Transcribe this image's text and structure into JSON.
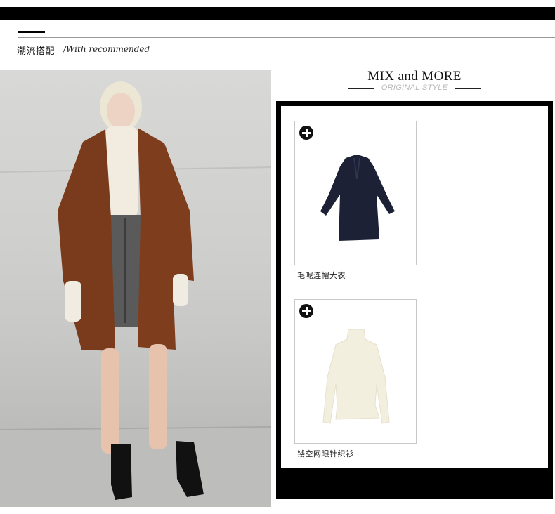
{
  "header": {
    "title": "潮流搭配",
    "subtitle": "/With recommended"
  },
  "showcase": {
    "title": "MIX and MORE",
    "tagline": "ORIGINAL STYLE"
  },
  "products": [
    {
      "name": "毛呢连帽大衣",
      "icon": "plus-circle-icon"
    },
    {
      "name": "镂空网眼针织衫",
      "icon": "plus-circle-icon"
    }
  ],
  "colors": {
    "bar": "#000000",
    "coat_brown": "#7a3b1c",
    "navy_coat": "#1c2136",
    "cream_knit": "#f3efdf"
  }
}
